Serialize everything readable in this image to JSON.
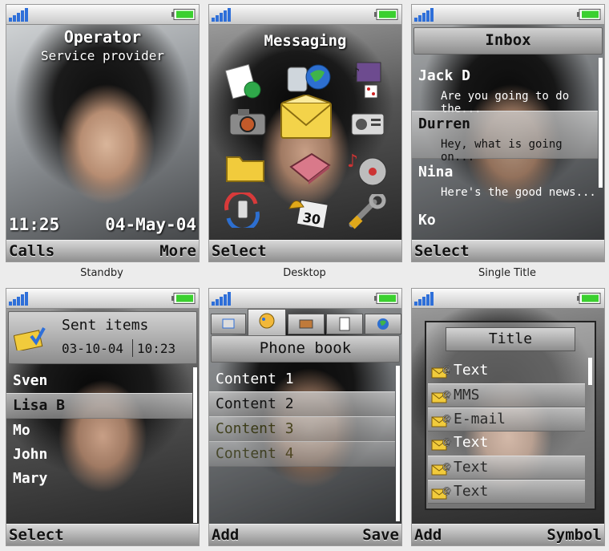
{
  "screens": {
    "standby": {
      "caption": "Standby",
      "operator": "Operator",
      "provider": "Service provider",
      "time": "11:25",
      "date": "04-May-04",
      "soft_left": "Calls",
      "soft_right": "More"
    },
    "desktop": {
      "caption": "Desktop",
      "title": "Messaging",
      "soft_left": "Select"
    },
    "single_title": {
      "caption": "Single Title",
      "title": "Inbox",
      "items": [
        {
          "name": "Jack D",
          "preview": "Are you going to do the..."
        },
        {
          "name": "Durren",
          "preview": "Hey, what is going on..."
        },
        {
          "name": "Nina",
          "preview": "Here's the good news..."
        },
        {
          "name": "Ko",
          "preview": ""
        }
      ],
      "soft_left": "Select"
    },
    "sent_items": {
      "title": "Sent items",
      "date": "03-10-04",
      "time": "10:23",
      "items": [
        "Sven",
        "Lisa B",
        "Mo",
        "John",
        "Mary"
      ],
      "soft_left": "Select"
    },
    "phone_book": {
      "title": "Phone book",
      "items": [
        "Content 1",
        "Content 2",
        "Content 3",
        "Content 4"
      ],
      "soft_left": "Add",
      "soft_right": "Save"
    },
    "popup": {
      "title": "Title",
      "items": [
        "Text",
        "MMS",
        "E-mail",
        "Text",
        "Text",
        "Text"
      ],
      "soft_left": "Add",
      "soft_right": "Symbol"
    }
  },
  "colors": {
    "battery": "#3bd02f",
    "signal": "#2e6fd9"
  }
}
